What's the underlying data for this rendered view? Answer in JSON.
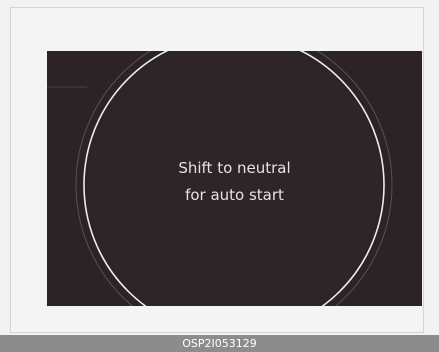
{
  "display": {
    "message_line1": "Shift to neutral",
    "message_line2": "for auto start",
    "background_color": "#2b2325",
    "ring_color": "#ececec"
  },
  "caption": {
    "code": "OSP2I053129"
  }
}
